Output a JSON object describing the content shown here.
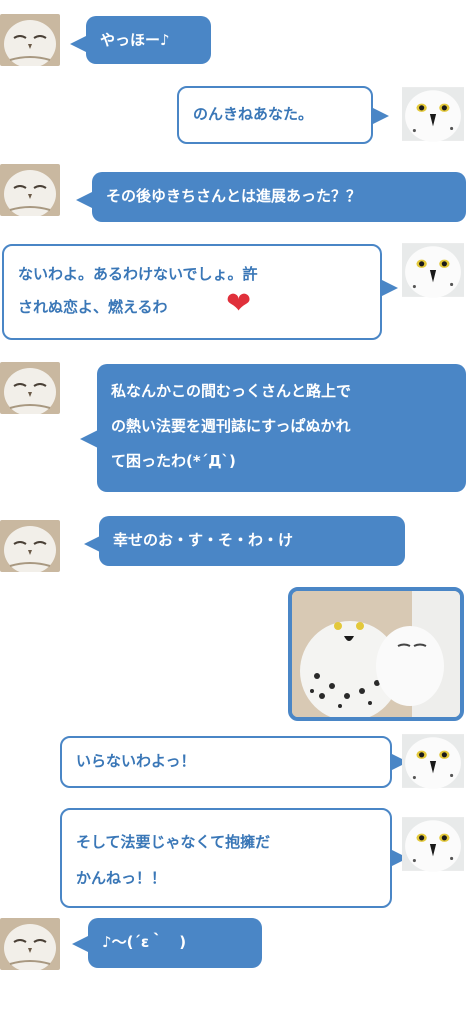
{
  "messages": [
    {
      "text": "やっほー♪"
    },
    {
      "text": "のんきねあなた。"
    },
    {
      "text": "その後ゆきちさんとは進展あった？？"
    },
    {
      "text": "ないわよ。あるわけないでしょ。許\nされぬ恋よ、燃えるわ"
    },
    {
      "text": "私なんかこの間むっくさんと路上で\nの熱い法要を週刊誌にすっぱぬかれ\nて困ったわ(*´Д`)"
    },
    {
      "text": "幸せのお・す・そ・わ・け"
    },
    {
      "text": "いらないわよっ！"
    },
    {
      "text": "そして法要じゃなくて抱擁だ\nかんねっ！！"
    },
    {
      "text": "♪～(´ε｀　)"
    }
  ],
  "heart_glyph": "❤",
  "colors": {
    "accent": "#4a86c6",
    "text_on_white": "#3a77b7",
    "heart": "#e0303b"
  }
}
